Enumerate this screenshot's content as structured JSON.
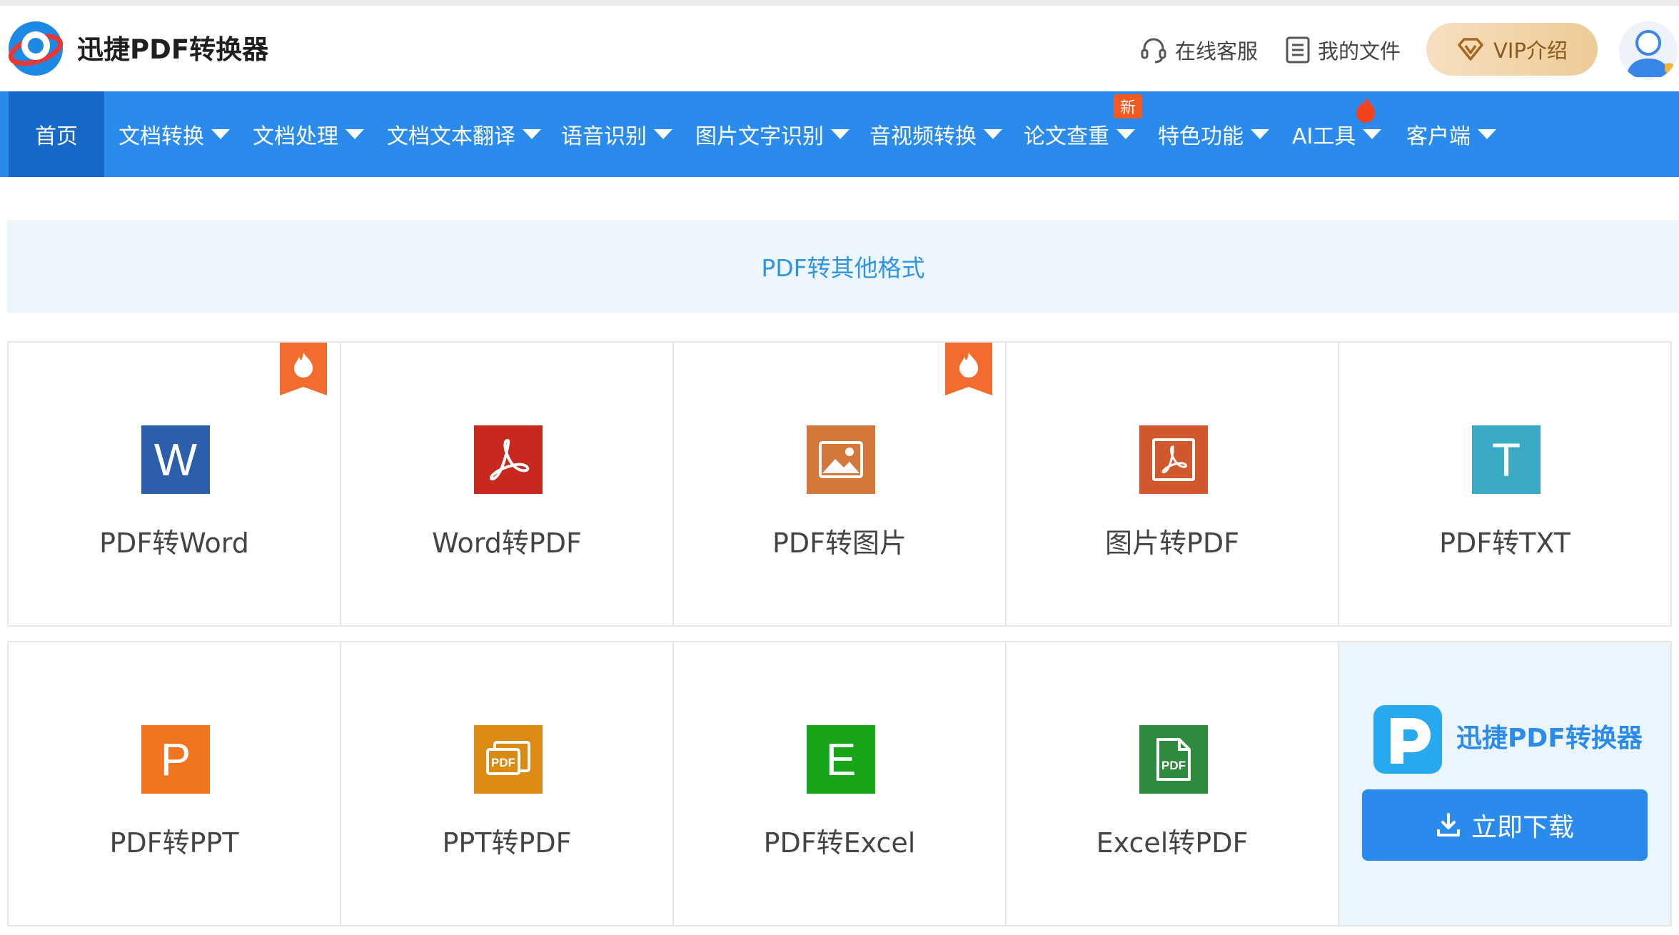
{
  "header": {
    "brand": "迅捷PDF转换器",
    "service": "在线客服",
    "my_files": "我的文件",
    "vip": "VIP介绍"
  },
  "nav": {
    "home": "首页",
    "items": [
      "文档转换",
      "文档处理",
      "文档文本翻译",
      "语音识别",
      "图片文字识别",
      "音视频转换",
      "论文查重",
      "特色功能",
      "AI工具",
      "客户端"
    ],
    "new_badge": "新"
  },
  "section": {
    "title": "PDF转其他格式"
  },
  "tools": [
    {
      "label": "PDF转Word",
      "icon": "word-icon",
      "color": "#2b5fab",
      "hot": true
    },
    {
      "label": "Word转PDF",
      "icon": "acrobat-icon",
      "color": "#c8281e",
      "hot": false
    },
    {
      "label": "PDF转图片",
      "icon": "image-icon",
      "color": "#d4773a",
      "hot": true
    },
    {
      "label": "图片转PDF",
      "icon": "image-to-pdf-icon",
      "color": "#d0582c",
      "hot": false
    },
    {
      "label": "PDF转TXT",
      "icon": "txt-icon",
      "color": "#3aa9c4",
      "hot": false
    },
    {
      "label": "PDF转PPT",
      "icon": "ppt-icon",
      "color": "#f0731f",
      "hot": false
    },
    {
      "label": "PPT转PDF",
      "icon": "ppt-to-pdf-icon",
      "color": "#db8a12",
      "hot": false
    },
    {
      "label": "PDF转Excel",
      "icon": "excel-icon",
      "color": "#17a51a",
      "hot": false
    },
    {
      "label": "Excel转PDF",
      "icon": "excel-to-pdf-icon",
      "color": "#2e8b3d",
      "hot": false
    }
  ],
  "download": {
    "title": "迅捷PDF转换器",
    "button": "立即下载",
    "word_letter": "W",
    "txt_letter": "T",
    "ppt_letter": "P",
    "excel_letter": "E",
    "pdf_tag": "PDF"
  },
  "colors": {
    "nav_bg": "#2b8bed",
    "nav_active": "#1669c9",
    "section_bg": "#eef6fd",
    "section_text": "#2f95e2",
    "hot": "#f36b2d"
  }
}
